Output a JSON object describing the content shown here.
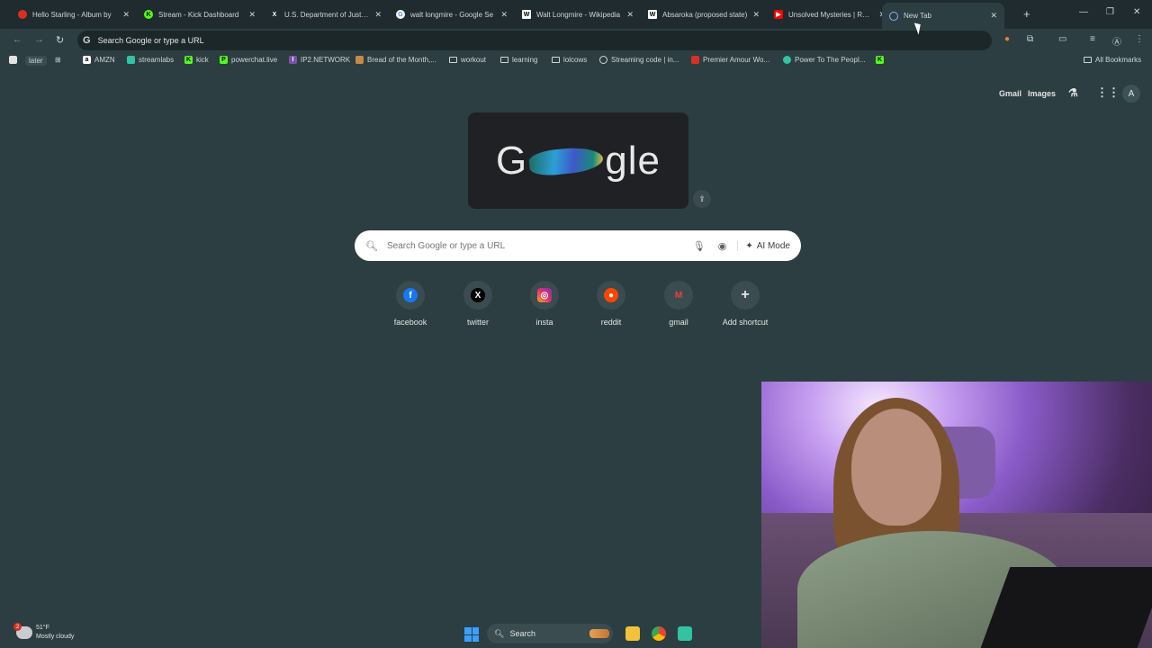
{
  "tabs": [
    {
      "title": "Hello Starling - Album by",
      "favicon": "music-icon",
      "color": "#d93025"
    },
    {
      "title": "Stream - Kick Dashboard",
      "favicon": "kick-icon",
      "color": "#53fc18"
    },
    {
      "title": "U.S. Department of Justice",
      "favicon": "x-icon",
      "color": "#ffffff"
    },
    {
      "title": "walt longmire - Google Se",
      "favicon": "google-icon",
      "color": "#4285f4"
    },
    {
      "title": "Walt Longmire - Wikipedia",
      "favicon": "wikipedia-icon",
      "color": "#ffffff"
    },
    {
      "title": "Absaroka (proposed state)",
      "favicon": "wikipedia-icon",
      "color": "#ffffff"
    },
    {
      "title": "Unsolved Mysteries | Robe",
      "favicon": "youtube-icon",
      "color": "#ff0000"
    },
    {
      "title": "New Tab",
      "favicon": "chrome-icon",
      "color": "#8ab4f8",
      "active": true
    }
  ],
  "toolbar": {
    "omnibox_text": "Search Google or type a URL"
  },
  "bookmarks": [
    {
      "label": "later",
      "type": "text"
    },
    {
      "label": "AMZN",
      "type": "site"
    },
    {
      "label": "streamlabs",
      "type": "site"
    },
    {
      "label": "kick",
      "type": "site"
    },
    {
      "label": "powerchat.live",
      "type": "site"
    },
    {
      "label": "IP2.NETWORK",
      "type": "site"
    },
    {
      "label": "Bread of the Month,...",
      "type": "site"
    },
    {
      "label": "workout",
      "type": "folder"
    },
    {
      "label": "learning",
      "type": "folder"
    },
    {
      "label": "lolcows",
      "type": "folder"
    },
    {
      "label": "Streaming code | in...",
      "type": "site"
    },
    {
      "label": "Premier Amour Wo...",
      "type": "site"
    },
    {
      "label": "Power To The Peopl...",
      "type": "site"
    }
  ],
  "all_bookmarks_label": "All Bookmarks",
  "ntp": {
    "gmail_label": "Gmail",
    "images_label": "Images",
    "avatar_letter": "A",
    "doodle_left": "G",
    "doodle_right": "gle",
    "search_placeholder": "Search Google or type a URL",
    "ai_mode_label": "AI Mode"
  },
  "shortcuts": [
    {
      "label": "facebook",
      "icon": "facebook-icon",
      "color": "#1877f2",
      "glyph": "f"
    },
    {
      "label": "twitter",
      "icon": "x-icon",
      "color": "#000000",
      "glyph": "𝕏"
    },
    {
      "label": "insta",
      "icon": "instagram-icon",
      "color": "#e1306c",
      "glyph": "◎"
    },
    {
      "label": "reddit",
      "icon": "reddit-icon",
      "color": "#ff4500",
      "glyph": "●"
    },
    {
      "label": "gmail",
      "icon": "gmail-icon",
      "color": "#ea4335",
      "glyph": "M"
    },
    {
      "label": "Add shortcut",
      "icon": "plus-icon",
      "color": "#3a4c50",
      "glyph": "+"
    }
  ],
  "taskbar": {
    "weather_temp": "51°F",
    "weather_desc": "Mostly cloudy",
    "weather_badge": "2",
    "search_label": "Search"
  }
}
